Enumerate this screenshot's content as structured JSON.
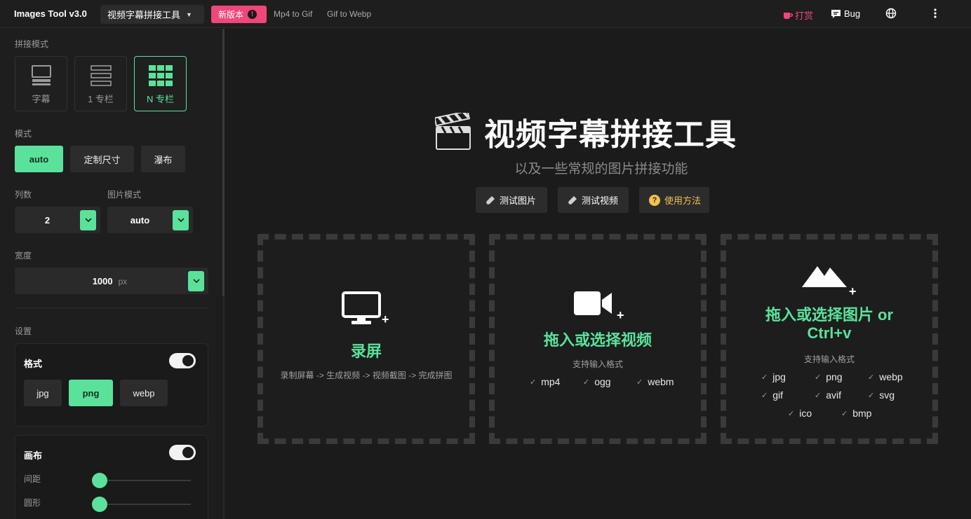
{
  "header": {
    "brand": "Images Tool v3.0",
    "tool_select": "视频字幕拼接工具",
    "new_badge": "新版本",
    "links": [
      "Mp4 to Gif",
      "Gif to Webp"
    ],
    "donate": "打赏",
    "bug": "Bug"
  },
  "sidebar": {
    "mode_label": "拼接模式",
    "modes": [
      "字幕",
      "1 专栏",
      "N 专栏"
    ],
    "active_mode": "N 专栏",
    "type_label": "模式",
    "types": [
      "auto",
      "定制尺寸",
      "瀑布"
    ],
    "active_type": "auto",
    "columns_label": "列数",
    "columns_value": "2",
    "image_mode_label": "图片模式",
    "image_mode_value": "auto",
    "width_label": "宽度",
    "width_value": "1000",
    "width_unit": "px",
    "settings_label": "设置",
    "format_panel": {
      "title": "格式",
      "enabled": true,
      "options": [
        "jpg",
        "png",
        "webp"
      ],
      "active": "png"
    },
    "canvas_panel": {
      "title": "画布",
      "enabled": true,
      "spacing_label": "间距",
      "round_label": "圆形",
      "spacing_value": 0,
      "round_value": 0
    }
  },
  "main": {
    "title": "视频字幕拼接工具",
    "subtitle": "以及一些常规的图片拼接功能",
    "actions": [
      "测试图片",
      "测试视频",
      "使用方法"
    ],
    "record": {
      "title": "录屏",
      "desc": "录制屏幕 -> 生成视频 -> 视频截图 -> 完成拼图"
    },
    "video": {
      "title": "拖入或选择视频",
      "formats_label": "支持输入格式",
      "formats": [
        "mp4",
        "ogg",
        "webm"
      ]
    },
    "image": {
      "title_line1": "拖入或选择图片 or",
      "title_line2": "Ctrl+v",
      "formats_label": "支持输入格式",
      "formats": [
        "jpg",
        "png",
        "webp",
        "gif",
        "avif",
        "svg",
        "ico",
        "bmp"
      ]
    }
  },
  "colors": {
    "accent": "#5ae29b",
    "pink": "#f0477a",
    "help": "#f2c14e",
    "bg": "#1b1b1b"
  }
}
